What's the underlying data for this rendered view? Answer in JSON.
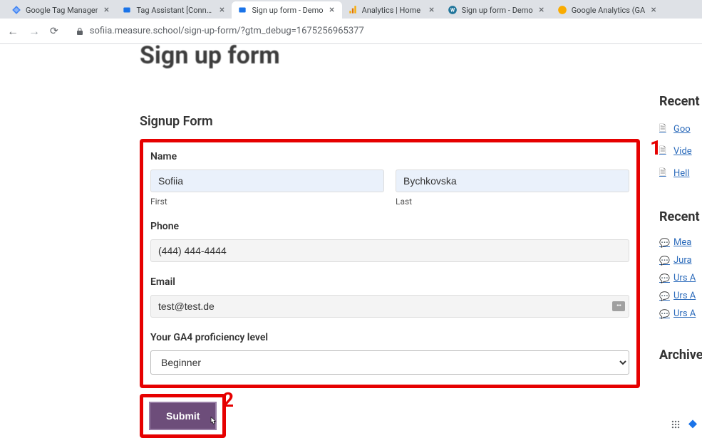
{
  "tabs": [
    {
      "title": "Google Tag Manager",
      "favicon_color": "#1a73e8"
    },
    {
      "title": "Tag Assistant [Connec",
      "favicon_color": "#1a73e8"
    },
    {
      "title": "Sign up form - Demo",
      "favicon_color": "#1a73e8",
      "active": true
    },
    {
      "title": "Analytics | Home",
      "favicon_color": "#f9ab00"
    },
    {
      "title": "Sign up form - Demo",
      "favicon_color": "#1e8cbe"
    },
    {
      "title": "Google Analytics (GA",
      "favicon_color": "#f9ab00"
    }
  ],
  "url": "sofiia.measure.school/sign-up-form/?gtm_debug=1675256965377",
  "page": {
    "title_big": "Sign up form",
    "form_heading": "Signup Form",
    "labels": {
      "name": "Name",
      "first": "First",
      "last": "Last",
      "phone": "Phone",
      "email": "Email",
      "proficiency": "Your GA4 proficiency level"
    },
    "values": {
      "first_name": "Sofiia",
      "last_name": "Bychkovska",
      "phone": "(444) 444-4444",
      "email": "test@test.de",
      "proficiency": "Beginner"
    },
    "submit_label": "Submit",
    "callouts": {
      "form": "1",
      "submit": "2"
    }
  },
  "sidebar": {
    "recent_posts_heading": "Recent Posts",
    "posts": [
      "Goo",
      "Vide",
      "Hell"
    ],
    "recent_comments_heading": "Recent Comments",
    "comments": [
      "Mea",
      "Jura",
      "Urs A",
      "Urs A",
      "Urs A"
    ],
    "archives_heading": "Archives"
  }
}
